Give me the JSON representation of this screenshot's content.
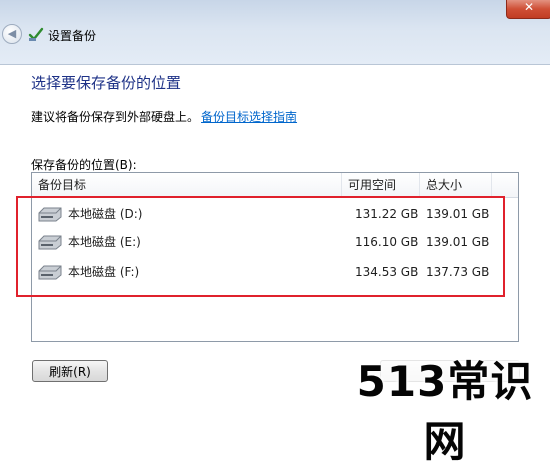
{
  "window": {
    "title": "设置备份",
    "close_glyph": "✕",
    "back_glyph": "◀"
  },
  "main": {
    "heading": "选择要保存备份的位置",
    "advice_text": "建议将备份保存到外部硬盘上。",
    "advice_link": "备份目标选择指南",
    "list_label": "保存备份的位置(B):"
  },
  "table": {
    "columns": [
      "备份目标",
      "可用空间",
      "总大小"
    ],
    "rows": [
      {
        "target": "本地磁盘 (D:)",
        "free": "131.22 GB",
        "total": "139.01 GB"
      },
      {
        "target": "本地磁盘 (E:)",
        "free": "116.10 GB",
        "total": "139.01 GB"
      },
      {
        "target": "本地磁盘 (F:)",
        "free": "134.53 GB",
        "total": "137.73 GB"
      }
    ]
  },
  "buttons": {
    "refresh": "刷新(R)"
  },
  "watermark": "513常识网",
  "colors": {
    "heading": "#1e3287",
    "link": "#0066cc",
    "highlight": "#e0212c"
  },
  "icons": {
    "back": "back-arrow-icon",
    "app": "backup-icon",
    "drive": "hard-drive-icon"
  }
}
